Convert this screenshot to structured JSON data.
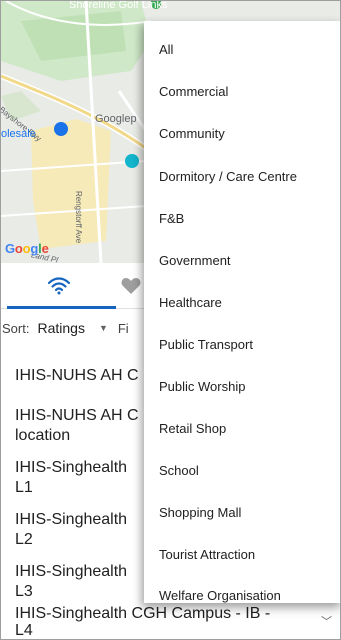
{
  "map": {
    "labels": {
      "golf": "Shoreline Golf Links",
      "road": "Bayshore Fwy",
      "googlep": "Googlep",
      "lesale": "olesale",
      "rengs": "Rengstorff Ave",
      "land": "Land Pl"
    },
    "logo": "Google"
  },
  "tabs": {
    "icons": [
      "wifi-icon",
      "heart-icon"
    ],
    "accent": "#1565c0"
  },
  "sort": {
    "label": "Sort:",
    "value": "Ratings",
    "filter_label": "Fi"
  },
  "locations": [
    "IHIS-NUHS AH C",
    "IHIS-NUHS AH C",
    "location",
    "IHIS-Singhealth",
    "L1",
    "IHIS-Singhealth",
    "L2",
    "IHIS-Singhealth",
    "L3",
    "IHIS-Singhealth CGH Campus - IB -",
    "L4"
  ],
  "category_menu": {
    "items": [
      "All",
      "Commercial",
      "Community",
      "Dormitory / Care Centre",
      "F&B",
      "Government",
      "Healthcare",
      "Public Transport",
      "Public Worship",
      "Retail Shop",
      "School",
      "Shopping Mall",
      "Tourist Attraction",
      "Welfare Organisation"
    ]
  }
}
